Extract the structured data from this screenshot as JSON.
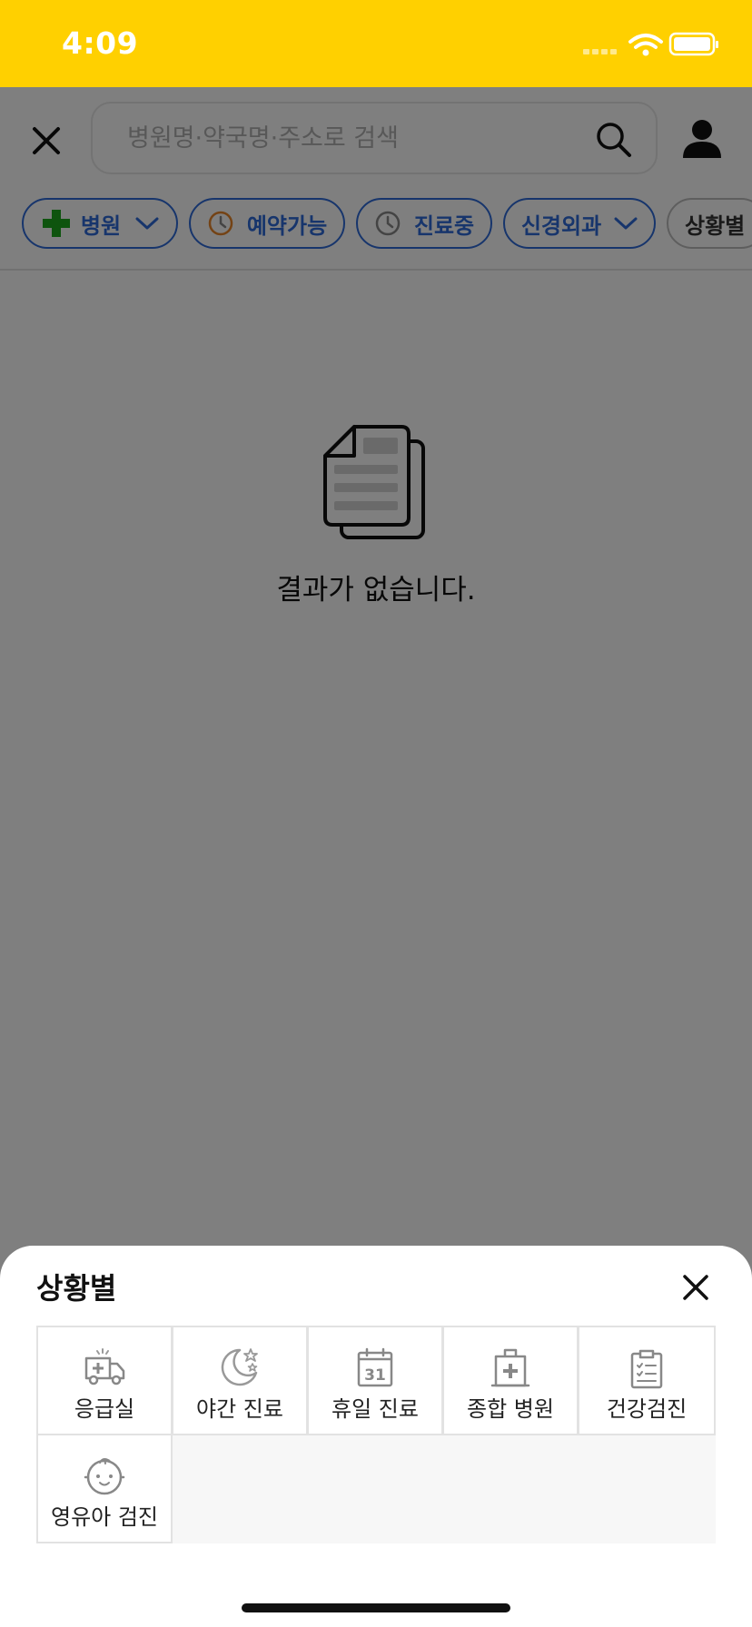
{
  "status_bar": {
    "time": "4:09"
  },
  "search": {
    "placeholder": "병원명·약국명·주소로 검색"
  },
  "filters": [
    {
      "label": "병원"
    },
    {
      "label": "예약가능"
    },
    {
      "label": "진료중"
    },
    {
      "label": "신경외과"
    },
    {
      "label": "상황별"
    }
  ],
  "empty_state": {
    "message": "결과가 없습니다."
  },
  "sheet": {
    "title": "상황별",
    "items": [
      {
        "label": "응급실",
        "icon": "ambulance-icon"
      },
      {
        "label": "야간 진료",
        "icon": "moon-star-icon"
      },
      {
        "label": "휴일 진료",
        "icon": "calendar-icon",
        "day": "31"
      },
      {
        "label": "종합 병원",
        "icon": "hospital-icon"
      },
      {
        "label": "건강검진",
        "icon": "clipboard-checklist-icon"
      },
      {
        "label": "영유아 검진",
        "icon": "baby-face-icon"
      }
    ]
  },
  "colors": {
    "status_bar": "#FFD000",
    "accent_blue": "#2E6BD8",
    "hospital_green": "#1DA81D",
    "clock_orange": "#E8862B"
  }
}
